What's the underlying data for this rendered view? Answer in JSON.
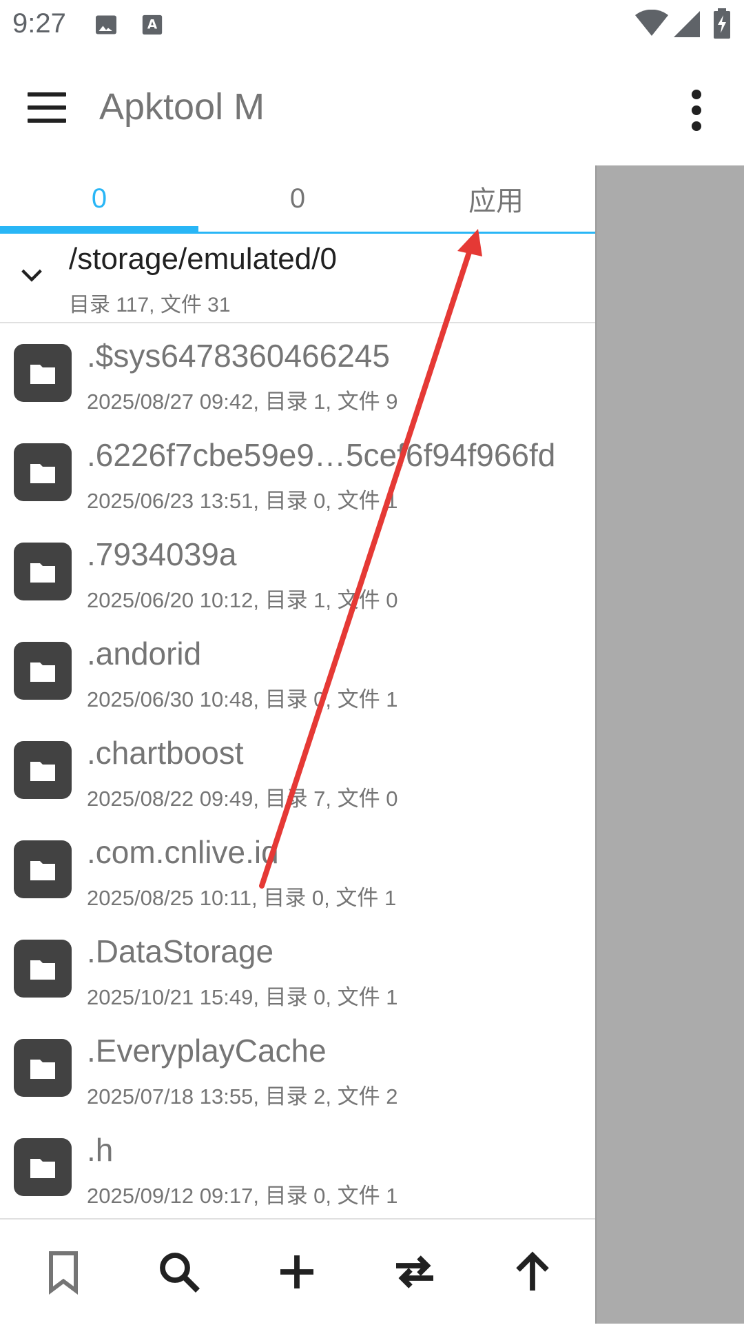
{
  "status_bar": {
    "time": "9:27",
    "icons": [
      "image-icon",
      "font-icon",
      "wifi-icon",
      "signal-icon",
      "battery-charging-icon"
    ]
  },
  "app_bar": {
    "title": "Apktool M",
    "menu_icon": "hamburger-menu-icon",
    "overflow_icon": "more-vert-icon"
  },
  "tabs": [
    {
      "label": "0",
      "active": true
    },
    {
      "label": "0",
      "active": false
    },
    {
      "label": "应用",
      "active": false
    }
  ],
  "path_header": {
    "path": "/storage/emulated/0",
    "summary": "目录 117, 文件 31"
  },
  "files": [
    {
      "name": ".$sys6478360466245",
      "meta": "2025/08/27 09:42, 目录 1, 文件 9"
    },
    {
      "name": ".6226f7cbe59e9…5cef6f94f966fd",
      "meta": "2025/06/23 13:51, 目录 0, 文件 1"
    },
    {
      "name": ".7934039a",
      "meta": "2025/06/20 10:12, 目录 1, 文件 0"
    },
    {
      "name": ".andorid",
      "meta": "2025/06/30 10:48, 目录 0, 文件 1"
    },
    {
      "name": ".chartboost",
      "meta": "2025/08/22 09:49, 目录 7, 文件 0"
    },
    {
      "name": ".com.cnlive.id",
      "meta": "2025/08/25 10:11, 目录 0, 文件 1"
    },
    {
      "name": ".DataStorage",
      "meta": "2025/10/21 15:49, 目录 0, 文件 1"
    },
    {
      "name": ".EveryplayCache",
      "meta": "2025/07/18 13:55, 目录 2, 文件 2"
    },
    {
      "name": ".h",
      "meta": "2025/09/12 09:17, 目录 0, 文件 1"
    }
  ],
  "bottom_bar": {
    "buttons": [
      "bookmark-icon",
      "search-icon",
      "add-icon",
      "swap-icon",
      "arrow-up-icon"
    ]
  },
  "colors": {
    "accent": "#29b6f6",
    "folder_bg": "#424242",
    "side_panel": "#ababab",
    "annotation_arrow": "#e53935"
  }
}
